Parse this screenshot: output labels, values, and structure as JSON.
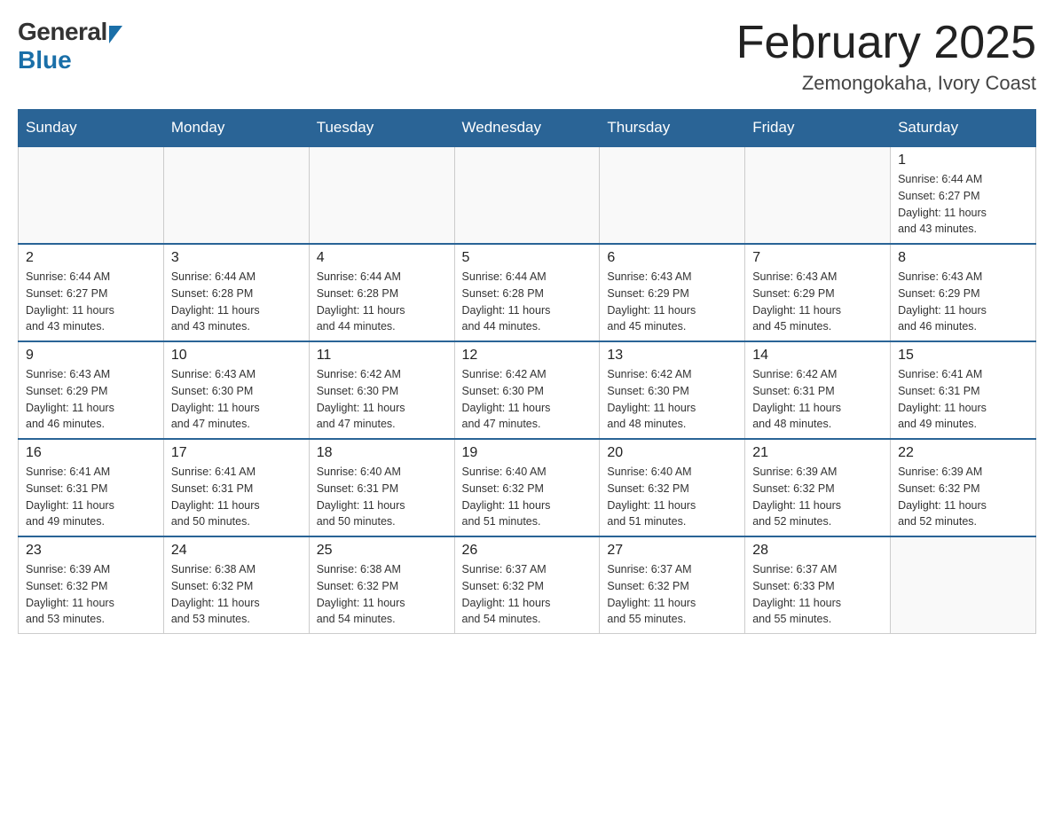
{
  "header": {
    "title": "February 2025",
    "location": "Zemongokaha, Ivory Coast",
    "logo_general": "General",
    "logo_blue": "Blue"
  },
  "days_of_week": [
    "Sunday",
    "Monday",
    "Tuesday",
    "Wednesday",
    "Thursday",
    "Friday",
    "Saturday"
  ],
  "weeks": [
    {
      "days": [
        {
          "num": "",
          "info": ""
        },
        {
          "num": "",
          "info": ""
        },
        {
          "num": "",
          "info": ""
        },
        {
          "num": "",
          "info": ""
        },
        {
          "num": "",
          "info": ""
        },
        {
          "num": "",
          "info": ""
        },
        {
          "num": "1",
          "info": "Sunrise: 6:44 AM\nSunset: 6:27 PM\nDaylight: 11 hours\nand 43 minutes."
        }
      ]
    },
    {
      "days": [
        {
          "num": "2",
          "info": "Sunrise: 6:44 AM\nSunset: 6:27 PM\nDaylight: 11 hours\nand 43 minutes."
        },
        {
          "num": "3",
          "info": "Sunrise: 6:44 AM\nSunset: 6:28 PM\nDaylight: 11 hours\nand 43 minutes."
        },
        {
          "num": "4",
          "info": "Sunrise: 6:44 AM\nSunset: 6:28 PM\nDaylight: 11 hours\nand 44 minutes."
        },
        {
          "num": "5",
          "info": "Sunrise: 6:44 AM\nSunset: 6:28 PM\nDaylight: 11 hours\nand 44 minutes."
        },
        {
          "num": "6",
          "info": "Sunrise: 6:43 AM\nSunset: 6:29 PM\nDaylight: 11 hours\nand 45 minutes."
        },
        {
          "num": "7",
          "info": "Sunrise: 6:43 AM\nSunset: 6:29 PM\nDaylight: 11 hours\nand 45 minutes."
        },
        {
          "num": "8",
          "info": "Sunrise: 6:43 AM\nSunset: 6:29 PM\nDaylight: 11 hours\nand 46 minutes."
        }
      ]
    },
    {
      "days": [
        {
          "num": "9",
          "info": "Sunrise: 6:43 AM\nSunset: 6:29 PM\nDaylight: 11 hours\nand 46 minutes."
        },
        {
          "num": "10",
          "info": "Sunrise: 6:43 AM\nSunset: 6:30 PM\nDaylight: 11 hours\nand 47 minutes."
        },
        {
          "num": "11",
          "info": "Sunrise: 6:42 AM\nSunset: 6:30 PM\nDaylight: 11 hours\nand 47 minutes."
        },
        {
          "num": "12",
          "info": "Sunrise: 6:42 AM\nSunset: 6:30 PM\nDaylight: 11 hours\nand 47 minutes."
        },
        {
          "num": "13",
          "info": "Sunrise: 6:42 AM\nSunset: 6:30 PM\nDaylight: 11 hours\nand 48 minutes."
        },
        {
          "num": "14",
          "info": "Sunrise: 6:42 AM\nSunset: 6:31 PM\nDaylight: 11 hours\nand 48 minutes."
        },
        {
          "num": "15",
          "info": "Sunrise: 6:41 AM\nSunset: 6:31 PM\nDaylight: 11 hours\nand 49 minutes."
        }
      ]
    },
    {
      "days": [
        {
          "num": "16",
          "info": "Sunrise: 6:41 AM\nSunset: 6:31 PM\nDaylight: 11 hours\nand 49 minutes."
        },
        {
          "num": "17",
          "info": "Sunrise: 6:41 AM\nSunset: 6:31 PM\nDaylight: 11 hours\nand 50 minutes."
        },
        {
          "num": "18",
          "info": "Sunrise: 6:40 AM\nSunset: 6:31 PM\nDaylight: 11 hours\nand 50 minutes."
        },
        {
          "num": "19",
          "info": "Sunrise: 6:40 AM\nSunset: 6:32 PM\nDaylight: 11 hours\nand 51 minutes."
        },
        {
          "num": "20",
          "info": "Sunrise: 6:40 AM\nSunset: 6:32 PM\nDaylight: 11 hours\nand 51 minutes."
        },
        {
          "num": "21",
          "info": "Sunrise: 6:39 AM\nSunset: 6:32 PM\nDaylight: 11 hours\nand 52 minutes."
        },
        {
          "num": "22",
          "info": "Sunrise: 6:39 AM\nSunset: 6:32 PM\nDaylight: 11 hours\nand 52 minutes."
        }
      ]
    },
    {
      "days": [
        {
          "num": "23",
          "info": "Sunrise: 6:39 AM\nSunset: 6:32 PM\nDaylight: 11 hours\nand 53 minutes."
        },
        {
          "num": "24",
          "info": "Sunrise: 6:38 AM\nSunset: 6:32 PM\nDaylight: 11 hours\nand 53 minutes."
        },
        {
          "num": "25",
          "info": "Sunrise: 6:38 AM\nSunset: 6:32 PM\nDaylight: 11 hours\nand 54 minutes."
        },
        {
          "num": "26",
          "info": "Sunrise: 6:37 AM\nSunset: 6:32 PM\nDaylight: 11 hours\nand 54 minutes."
        },
        {
          "num": "27",
          "info": "Sunrise: 6:37 AM\nSunset: 6:32 PM\nDaylight: 11 hours\nand 55 minutes."
        },
        {
          "num": "28",
          "info": "Sunrise: 6:37 AM\nSunset: 6:33 PM\nDaylight: 11 hours\nand 55 minutes."
        },
        {
          "num": "",
          "info": ""
        }
      ]
    }
  ]
}
